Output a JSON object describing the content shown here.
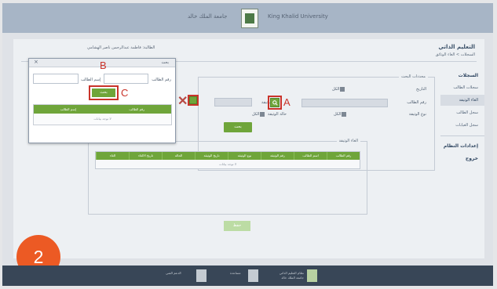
{
  "header": {
    "university_ar": "جامعة الملك خالد",
    "university_en": "King Khalid University"
  },
  "page": {
    "title": "التعليم الذاتي",
    "breadcrumb": "السجلات > الغاء الوثائق",
    "user_line": "الطالبة: فاطمة عبدالرحمن ناصر الهشامي"
  },
  "sidebar": {
    "section": "السجلات",
    "items": [
      "سجلات الطالب",
      "الغاء الوثيقة",
      "سجل الطالب",
      "سجل الغيابات"
    ],
    "section2": "إعدادات النظام",
    "footer": "خروج"
  },
  "search_form": {
    "legend": "محددات البحث",
    "date_label": "التاريخ",
    "date_placeholder": "الكل",
    "student_no_label": "رقم الطالب",
    "doc_no_label": "رقم الوثيقة",
    "doc_type_label": "نوع الوثيقة",
    "doc_type_value": "الكل",
    "doc_status_label": "حالة الوثيقة",
    "doc_status_value": "الكل",
    "search_button": "بحث"
  },
  "results": {
    "legend": "الغاء الوثيقة",
    "columns": [
      "رقم الطالب",
      "اسم الطالب",
      "رقم الوثيقة",
      "نوع الوثيقة",
      "تاريخ الوثيقة",
      "الحالة",
      "تاريخ الالغاء",
      "الغاء"
    ],
    "empty_text": "لا توجد بيانات",
    "save_button": "حفظ"
  },
  "dialog": {
    "title": "بحث",
    "close": "×",
    "student_no_label": "رقم الطالب",
    "student_name_label": "إسم الطالب",
    "search_button": "بحث",
    "columns": [
      "رقم الطالب",
      "إسم الطالب"
    ],
    "empty_text": "لا توجد بيانات"
  },
  "annotations": {
    "a": "A",
    "b": "B",
    "c": "C",
    "x": "✕"
  },
  "step": "2",
  "footer": {
    "item1": "الدعم الفني",
    "item2": "مساعدة",
    "item3_line1": "نظام التعليم الذاتي",
    "item3_line2": "جامعة الملك خالد"
  },
  "colors": {
    "accent_green": "#6fa53a",
    "highlight_red": "#c9332a",
    "step_orange": "#ec5a24",
    "footer_bg": "#384657",
    "header_bg": "#a7b5c6"
  }
}
